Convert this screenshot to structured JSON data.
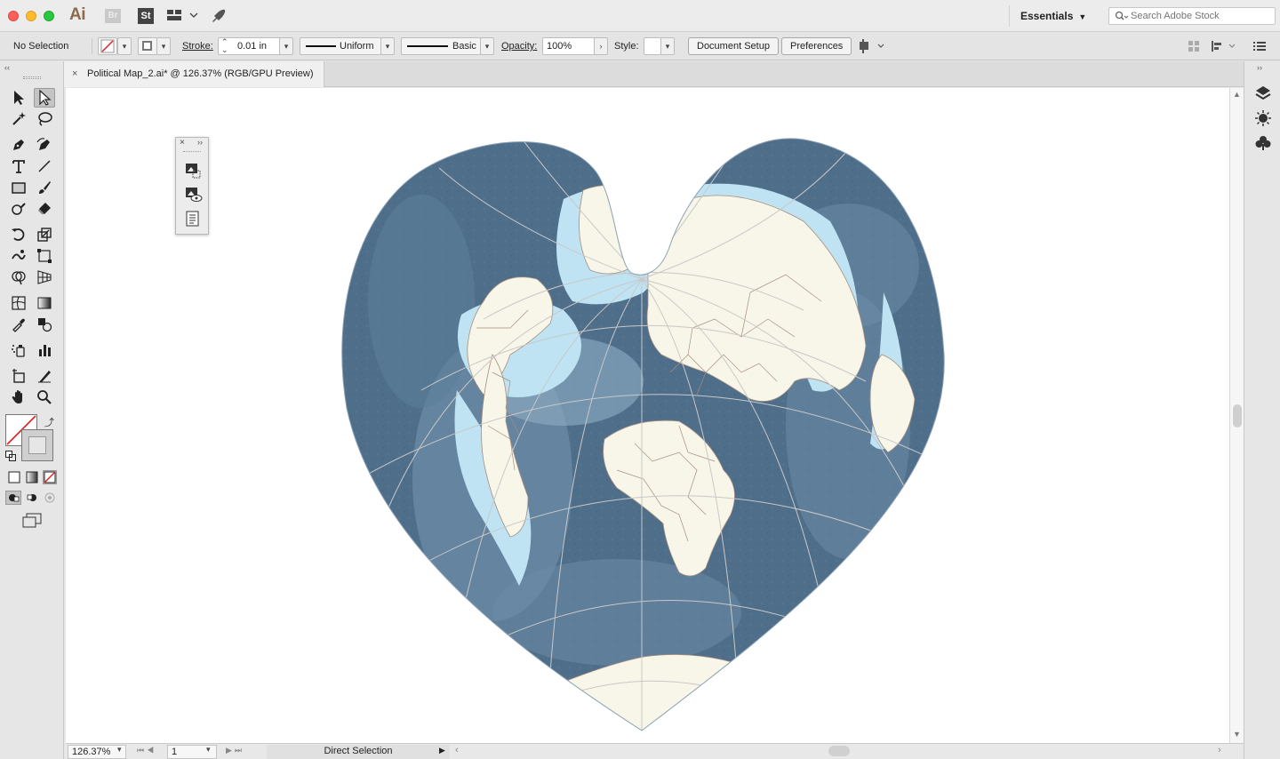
{
  "app": {
    "logo": "Ai",
    "bridge_label": "Br",
    "stock_label": "St",
    "workspace": "Essentials",
    "search_placeholder": "Search Adobe Stock"
  },
  "control_bar": {
    "selection_status": "No Selection",
    "stroke_label": "Stroke:",
    "stroke_value": "0.01 in",
    "profile_label": "Uniform",
    "brush_label": "Basic",
    "opacity_label": "Opacity:",
    "opacity_value": "100%",
    "style_label": "Style:",
    "document_setup": "Document Setup",
    "preferences": "Preferences"
  },
  "document": {
    "tab_close": "×",
    "tab_title": "Political Map_2.ai* @ 126.37% (RGB/GPU Preview)"
  },
  "status_bar": {
    "zoom": "126.37%",
    "page": "1",
    "tool_status": "Direct Selection"
  },
  "tools": [
    "selection-tool",
    "direct-selection-tool",
    "magic-wand-tool",
    "lasso-tool",
    "pen-tool",
    "curvature-tool",
    "type-tool",
    "line-tool",
    "rectangle-tool",
    "paintbrush-tool",
    "shaper-tool",
    "eraser-tool",
    "rotate-tool",
    "scale-tool",
    "warp-tool",
    "free-transform-tool",
    "shape-builder-tool",
    "perspective-grid-tool",
    "mesh-tool",
    "gradient-tool",
    "eyedropper-tool",
    "blend-tool",
    "symbol-sprayer-tool",
    "graph-tool",
    "artboard-tool",
    "slice-tool",
    "hand-tool",
    "zoom-tool"
  ],
  "colors": {
    "ocean_deep": "#4b6a86",
    "ocean_mid": "#6a89a4",
    "ocean_shallow": "#8fadc4",
    "shelf": "#bfe3f2",
    "land": "#f8f6e8",
    "border": "#a58e80",
    "graticule": "#c8c8c8"
  }
}
